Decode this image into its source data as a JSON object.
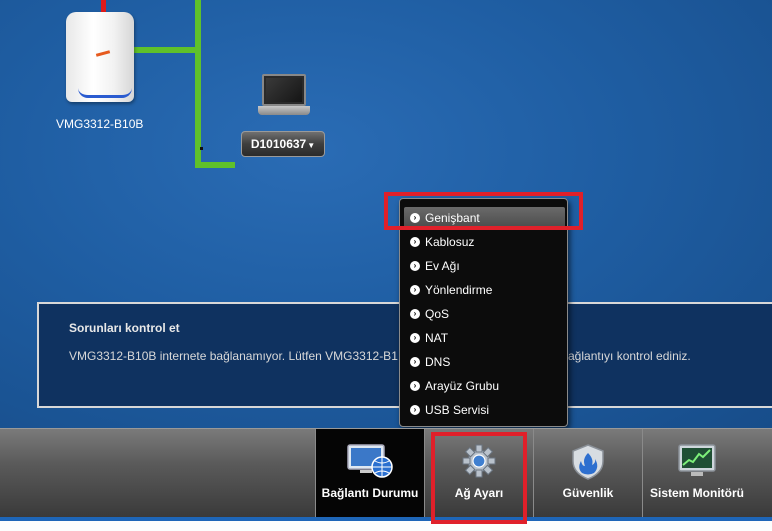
{
  "network": {
    "router_label": "VMG3312-B10B",
    "device_label": "D1010637"
  },
  "panel": {
    "title": "Sorunları kontrol et",
    "message_left": "VMG3312-B10B internete bağlanamıyor. Lütfen VMG3312-B1",
    "message_right": "ağlantıyı kontrol ediniz."
  },
  "menu": {
    "items": [
      {
        "label": "Genişbant",
        "active": true
      },
      {
        "label": "Kablosuz"
      },
      {
        "label": "Ev Ağı"
      },
      {
        "label": "Yönlendirme"
      },
      {
        "label": "QoS"
      },
      {
        "label": "NAT"
      },
      {
        "label": "DNS"
      },
      {
        "label": "Arayüz Grubu"
      },
      {
        "label": "USB Servisi"
      }
    ]
  },
  "toolbar": {
    "tabs": [
      {
        "label": "Bağlantı Durumu",
        "icon": "monitor-globe-icon",
        "active": true
      },
      {
        "label": "Ağ Ayarı",
        "icon": "gear-icon"
      },
      {
        "label": "Güvenlik",
        "icon": "shield-fire-icon"
      },
      {
        "label": "Sistem Monitörü",
        "icon": "chart-monitor-icon"
      }
    ]
  },
  "colors": {
    "highlight": "#e0202a",
    "background": "#1f5ea3",
    "line_green": "#5fc12a",
    "line_red": "#e01a1a"
  }
}
